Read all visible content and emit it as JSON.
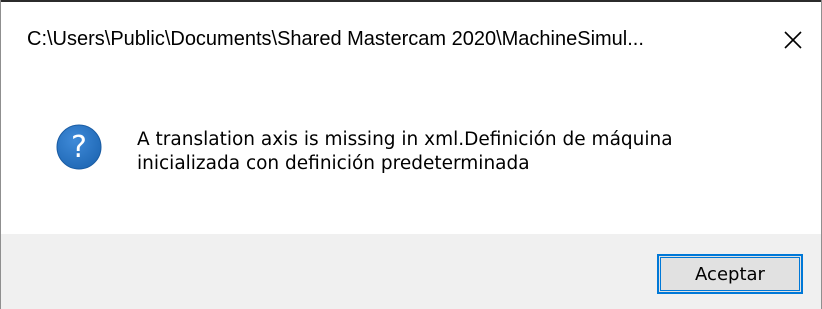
{
  "window": {
    "title": "C:\\Users\\Public\\Documents\\Shared Mastercam 2020\\MachineSimul...",
    "close_icon": "close-icon"
  },
  "dialog": {
    "icon": "question-icon",
    "icon_color": "#1f68b5",
    "message_line1": "A translation axis is missing in xml.Definición de máquina",
    "message_line2": "inicializada con definición predeterminada"
  },
  "buttons": {
    "ok_label": "Aceptar",
    "ok_focus_color": "#0078d7"
  }
}
